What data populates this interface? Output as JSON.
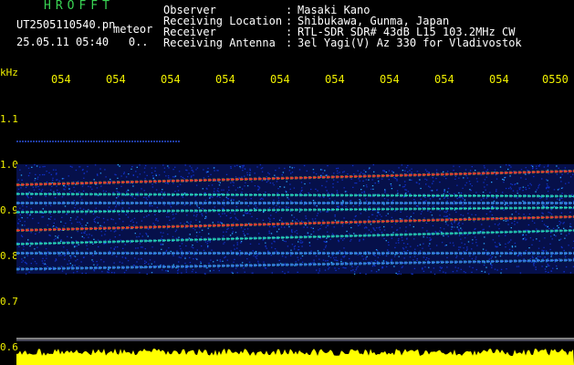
{
  "header": {
    "program": "HROFFT",
    "filename": "UT2505110540.pn",
    "tag": "meteor",
    "datetime": "25.05.11 05:40",
    "datetime_suffix": "0.."
  },
  "info": [
    {
      "label": "Observer",
      "value": "Masaki Kano"
    },
    {
      "label": "Receiving Location",
      "value": "Shibukawa, Gunma, Japan"
    },
    {
      "label": "Receiver",
      "value": "RTL-SDR SDR# 43dB L15 103.2MHz CW"
    },
    {
      "label": "Receiving Antenna",
      "value": "3el Yagi(V) Az 330 for Vladivostok"
    }
  ],
  "axis": {
    "unit": "kHz",
    "y_ticks": [
      "1.1",
      "1.0",
      "0.9",
      "0.8",
      "0.7",
      "0.6"
    ],
    "x_ticks": [
      "054",
      "054",
      "054",
      "054",
      "054",
      "054",
      "054",
      "054",
      "054",
      "0550"
    ]
  },
  "colors": {
    "background": "#000000",
    "header_green": "#39d353",
    "label_white": "#ffffff",
    "tick_yellow": "#f0f000",
    "noise_blue": "#1030c8",
    "trace_red": "#ff3030",
    "strip_yellow": "#ffff00"
  },
  "chart_data": {
    "type": "heatmap",
    "ylabel": "kHz",
    "ylim": [
      0.6,
      1.1
    ],
    "traces_khz": [
      {
        "start": 0.955,
        "end": 0.985,
        "intensity": "high"
      },
      {
        "start": 0.855,
        "end": 0.885,
        "intensity": "high"
      },
      {
        "start": 0.935,
        "end": 0.93,
        "intensity": "medium"
      },
      {
        "start": 0.895,
        "end": 0.905,
        "intensity": "medium"
      },
      {
        "start": 0.915,
        "end": 0.915,
        "intensity": "low"
      },
      {
        "start": 0.825,
        "end": 0.855,
        "intensity": "medium"
      },
      {
        "start": 0.805,
        "end": 0.805,
        "intensity": "low"
      },
      {
        "start": 0.77,
        "end": 0.79,
        "intensity": "low"
      }
    ],
    "band_khz": [
      0.76,
      1.0
    ]
  }
}
